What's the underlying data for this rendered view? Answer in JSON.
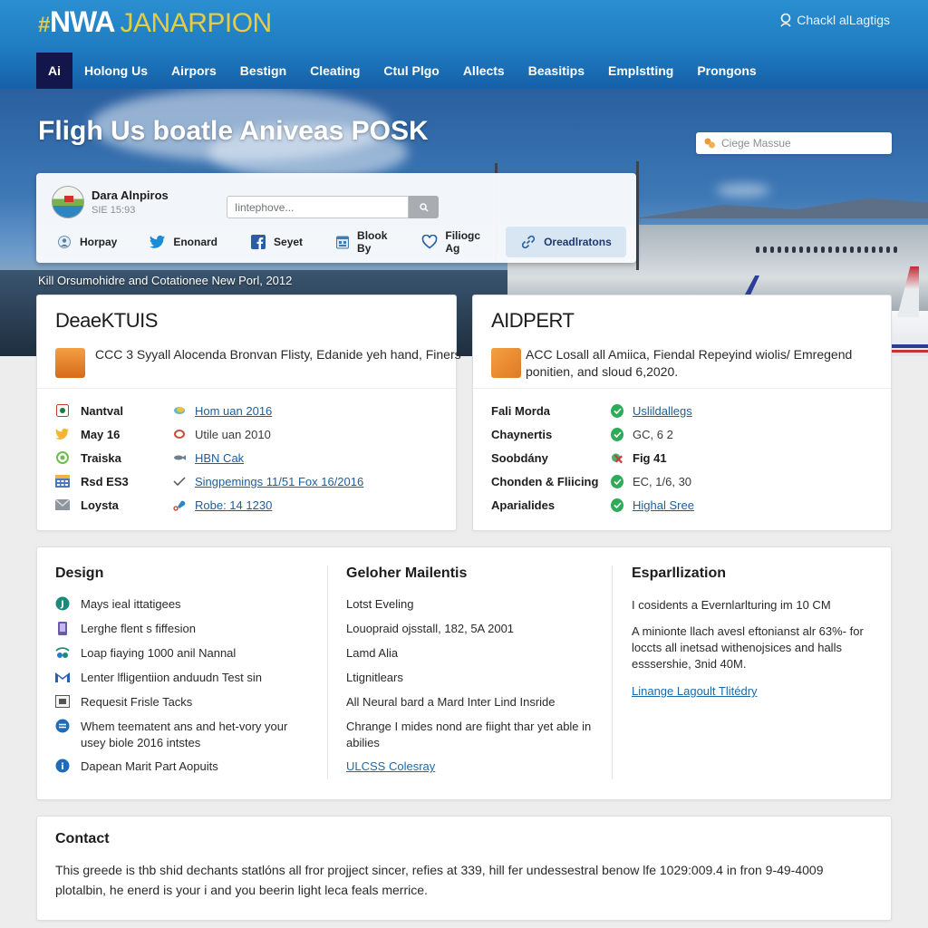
{
  "header": {
    "logo_hash": "#",
    "logo_main": "NWA",
    "logo_sub": "JANARPION",
    "top_link": {
      "icon": "user-icon",
      "label": "Chackl alLagtigs"
    },
    "nav": [
      {
        "label": "Ai",
        "active": true
      },
      {
        "label": "Holong Us"
      },
      {
        "label": "Airpors"
      },
      {
        "label": "Bestign"
      },
      {
        "label": "Cleating"
      },
      {
        "label": "Ctul Plgo"
      },
      {
        "label": "Allects"
      },
      {
        "label": "Beasitips"
      },
      {
        "label": "Emplstting"
      },
      {
        "label": "Prongons"
      }
    ]
  },
  "hero": {
    "title": "Fligh Us boatle Aniveas POSK",
    "search_placeholder": "Ciege Massue",
    "caption": "Kill Orsumohidre and Cotationee New Porl, 2012",
    "profile": {
      "name": "Dara Alnpiros",
      "subtitle": "SIE 15:93",
      "search_placeholder": "Iintephove...",
      "search_icon": "search-icon",
      "links": [
        {
          "label": "Horpay",
          "icon": "globe-user-icon"
        },
        {
          "label": "Enonard",
          "icon": "twitter-icon"
        },
        {
          "label": "Seyet",
          "icon": "facebook-icon"
        },
        {
          "label": "Blook By",
          "icon": "calendar-icon"
        },
        {
          "label": "Filiogc Ag",
          "icon": "heart-icon"
        },
        {
          "label": "Oreadlratons",
          "icon": "link-icon",
          "active": true
        }
      ]
    }
  },
  "departures": {
    "title": "DeaeKTUIS",
    "description": "CCC 3 Syyall Alocenda Bronvan Flisty, Edanide yeh hand, Finers",
    "rows": [
      {
        "icon": "record-icon",
        "label": "Nantval",
        "value_icon": "leaf-icon",
        "value": "Hom uan 2016",
        "link": true
      },
      {
        "icon": "bird-icon",
        "label": "May 16",
        "value_icon": "tag-icon",
        "value": "Utile uan 2010",
        "link": false
      },
      {
        "icon": "globe-icon",
        "label": "Traiska",
        "value_icon": "fish-icon",
        "value": "HBN Cak",
        "link": true
      },
      {
        "icon": "table-icon",
        "label": "Rsd ES3",
        "value_icon": "check-icon",
        "value": "Singpemings 11/51 Fox 16/2016",
        "link": true
      },
      {
        "icon": "mail-icon",
        "label": "Loysta",
        "value_icon": "pin-icon",
        "value": "Robe: 14 1230",
        "link": true
      }
    ]
  },
  "airport": {
    "title": "AIDPERT",
    "description": "ACC Losall all Amiica, Fiendal Repeyind wiolis/ Emregend ponitien, and sloud 6,2020.",
    "rows": [
      {
        "label": "Fali Morda",
        "status": "ok",
        "value": "Uslildallegs",
        "link": true
      },
      {
        "label": "Chaynertis",
        "status": "ok",
        "value": "GC, 6 2",
        "link": false
      },
      {
        "label": "Soobdány",
        "status": "warning",
        "value": "Fig 41",
        "link": false,
        "bold": true
      },
      {
        "label": "Chonden & Fliicing",
        "status": "ok",
        "value": "EC, 1/6, 30",
        "link": false
      },
      {
        "label": "Aparialides",
        "status": "ok",
        "value": "Highal Sree",
        "link": true
      }
    ]
  },
  "features": {
    "design": {
      "title": "Design",
      "items": [
        {
          "icon": "j-circle-icon",
          "text": "Mays ieal ittatigees"
        },
        {
          "icon": "phone-icon",
          "text": "Lerghe flent s fiffesion"
        },
        {
          "icon": "wifi-icon",
          "text": "Loap fiaying 1000 anil Nannal"
        },
        {
          "icon": "gmail-icon",
          "text": "Lenter lfligentiion anduudn Test sin"
        },
        {
          "icon": "image-icon",
          "text": "Requesit Frisle Tacks"
        },
        {
          "icon": "swap-icon",
          "text": "Whem teematent ans and het-vory your usey biole 2016 intstes"
        },
        {
          "icon": "info-icon",
          "text": "Dapean Marit Part Aopuits"
        }
      ]
    },
    "middle": {
      "title": "Geloher Mailentis",
      "items": [
        "Lotst Eveling",
        "Louopraid ojsstall, 182, 5A 2001",
        "Lamd Alia",
        "Ltignitlears",
        "All Neural bard a Mard Inter Lind Insride",
        "Chrange I mides nond are fiight thar yet able in abilies"
      ],
      "link": "ULCSS Colesray"
    },
    "right": {
      "title": "Esparllization",
      "paragraphs": [
        "I cosidents a Evernlarlturing im 10 CM",
        "A minionte llach avesl eftonianst alr 63%- for loccts all inetsad withenojsices and halls esssershie, 3nid 40M."
      ],
      "link": "Linange Lagoult Tlitédry"
    }
  },
  "contact": {
    "title": "Contact",
    "text": "This greede is thb shid dechants statlóns all fror projject sincer, refies at 339, hill fer undessestral benow lfe 1029:009.4 in fron 9-49-4009 plotalbin, he enerd is your i and you beerin light leca feals merrice."
  }
}
